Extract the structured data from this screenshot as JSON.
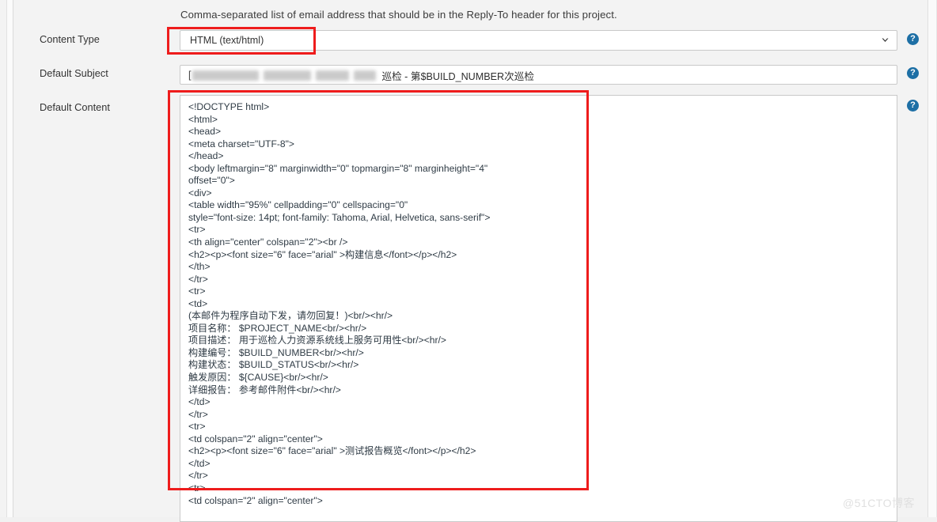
{
  "page": {
    "description": "Comma-separated list of email address that should be in the Reply-To header for this project.",
    "watermark": "@51CTO博客"
  },
  "fields": {
    "content_type": {
      "label": "Content Type",
      "value": "HTML (text/html)",
      "arrow_icon": "chevron-down-icon",
      "help_icon": "help-icon",
      "help_glyph": "?"
    },
    "default_subject": {
      "label": "Default Subject",
      "redacted_lead": "[",
      "visible_tail": "巡检 - 第$BUILD_NUMBER次巡检",
      "help_icon": "help-icon",
      "help_glyph": "?"
    },
    "default_content": {
      "label": "Default Content",
      "help_icon": "help-icon",
      "help_glyph": "?",
      "code": [
        "<!DOCTYPE html>",
        "<html>",
        "<head>",
        "<meta charset=\"UTF-8\">",
        "</head>",
        "<body leftmargin=\"8\" marginwidth=\"0\" topmargin=\"8\" marginheight=\"4\"",
        "offset=\"0\">",
        "<div>",
        "<table width=\"95%\" cellpadding=\"0\" cellspacing=\"0\"",
        "style=\"font-size: 14pt; font-family: Tahoma, Arial, Helvetica, sans-serif\">",
        "<tr>",
        "<th align=\"center\" colspan=\"2\"><br />",
        "<h2><p><font size=\"6\" face=\"arial\" >构建信息</font></p></h2>",
        "</th>",
        "</tr>",
        "<tr>",
        "<td>",
        "(本邮件为程序自动下发，请勿回复！)<br/><hr/>",
        "项目名称： $PROJECT_NAME<br/><hr/>",
        "项目描述： 用于巡检人力资源系统线上服务可用性<br/><hr/>",
        "构建编号： $BUILD_NUMBER<br/><hr/>",
        "构建状态： $BUILD_STATUS<br/><hr/>",
        "触发原因： ${CAUSE}<br/><hr/>",
        "详细报告： 参考邮件附件<br/><hr/>",
        "</td>",
        "</tr>",
        "<tr>",
        "<td colspan=\"2\" align=\"center\">",
        "<h2><p><font size=\"6\" face=\"arial\" >测试报告概览</font></p></h2>",
        "</td>",
        "</tr>",
        "<tr>",
        "<td colspan=\"2\" align=\"center\">",
        ""
      ]
    }
  },
  "annotations": {
    "highlight_content_type": "red-highlight-box",
    "highlight_default_content": "red-highlight-box"
  }
}
